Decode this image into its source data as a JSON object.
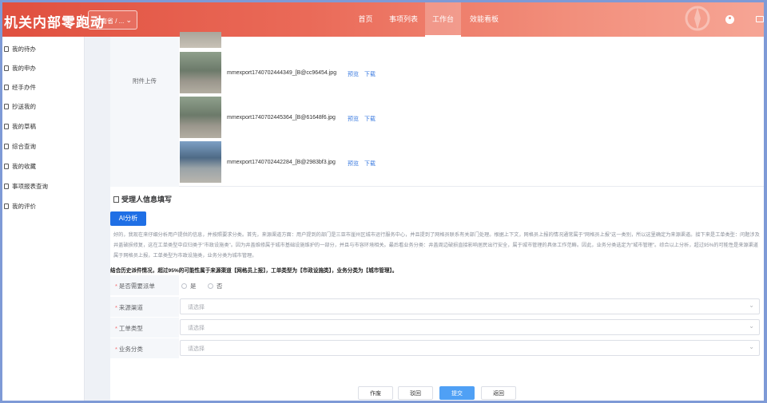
{
  "header": {
    "logo_text": "机关内部零跑动",
    "region_select": "海南省 / ...",
    "nav": [
      {
        "label": "首页"
      },
      {
        "label": "事项列表"
      },
      {
        "label": "工作台"
      },
      {
        "label": "效能看板"
      }
    ],
    "active_nav": "工作台"
  },
  "sidebar": {
    "items": [
      {
        "label": "我的待办"
      },
      {
        "label": "我的申办"
      },
      {
        "label": "经手办件"
      },
      {
        "label": "抄送我的"
      },
      {
        "label": "我的草稿"
      },
      {
        "label": "综合查询"
      },
      {
        "label": "我的收藏"
      },
      {
        "label": "事项报表查询"
      },
      {
        "label": "我的评价"
      }
    ]
  },
  "attachments": {
    "label": "附件上传",
    "preview_label": "预览",
    "download_label": "下载",
    "files": [
      {
        "name": "mmexport1740702444349_[B@cc96454.jpg"
      },
      {
        "name": "mmexport1740702445364_[B@61648f6.jpg"
      },
      {
        "name": "mmexport1740702442284_[B@2983bf3.jpg"
      }
    ]
  },
  "section": {
    "title": "受理人信息填写"
  },
  "ai": {
    "button_label": "AI分析",
    "analysis_text": "好的，我现在来仔细分析用户提供的信息，并按照要求分类。首先，来源渠道方面：用户提到的部门是三亚市崖州区城市运行服务中心，并且提到了网格员联系有关部门处理。根据上下文，网格员上报的情况通常属于\"网格员上报\"这一类别，所以这里确定为来源渠道。接下来是工单类型：问题涉及井盖破损修复，这在工单类型中应归类于\"市政设施类\"。因为井盖维修属于城市基础设施维护的一部分，并且与市容环境相关。最后看业务分类：井盖周边破损直接影响居民出行安全，属于城市管理的具体工作范畴。因此，业务分类选定为\"城市管理\"。综合以上分析，超过95%的可能性是来源渠道属于网格员上报，工单类型为市政设施类，业务分类为城市管理。",
    "summary": "结合历史派件情况，超过95%的可能性属于来源渠道【网格员上报】，工单类型为【市政设施类】，业务分类为【城市管理】。"
  },
  "form": {
    "fields": [
      {
        "label": "是否需要派单",
        "type": "radio",
        "options": [
          "是",
          "否"
        ]
      },
      {
        "label": "来源渠道",
        "type": "select",
        "placeholder": "请选择"
      },
      {
        "label": "工单类型",
        "type": "select",
        "placeholder": "请选择"
      },
      {
        "label": "业务分类",
        "type": "select",
        "placeholder": "请选择"
      }
    ]
  },
  "footer": {
    "buttons": [
      {
        "label": "作废"
      },
      {
        "label": "驳回"
      },
      {
        "label": "提交"
      },
      {
        "label": "返回"
      }
    ]
  },
  "colors": {
    "header_start": "#e0503f",
    "header_end": "#f6a595",
    "primary": "#1f6fe5",
    "link": "#3b7be0",
    "required_star": "#f56c6c"
  }
}
